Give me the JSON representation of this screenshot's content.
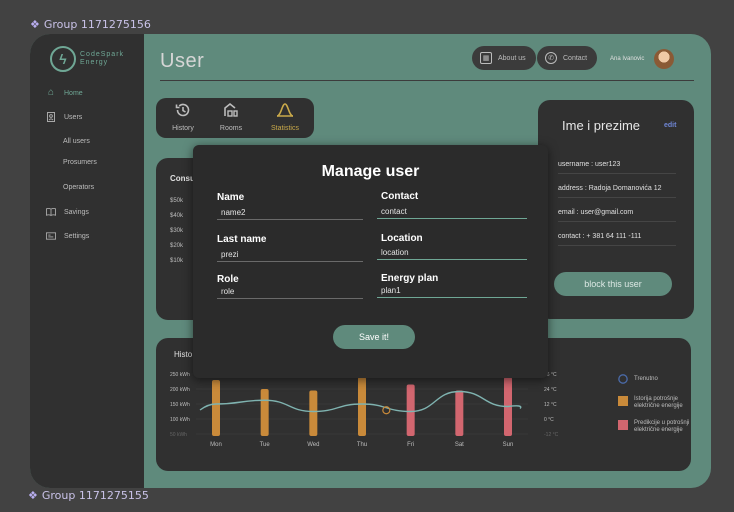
{
  "canvas": {
    "group_top": "Group 1171275156",
    "group_bottom": "Group 1171275155"
  },
  "brand": {
    "line1": "CodeSpark",
    "line2": "Energy"
  },
  "sidebar": {
    "items": [
      {
        "label": "Home",
        "icon": "home-icon",
        "active": true
      },
      {
        "label": "Users",
        "icon": "user-icon",
        "active": false
      },
      {
        "label": "Savings",
        "icon": "book-icon",
        "active": false
      },
      {
        "label": "Settings",
        "icon": "settings-icon",
        "active": false
      }
    ],
    "subitems": [
      "All users",
      "Prosumers",
      "Operators"
    ]
  },
  "header": {
    "title": "User",
    "about_label": "About us",
    "contact_label": "Contact",
    "user_name": "Ana Ivanovic"
  },
  "tabs": [
    {
      "label": "History",
      "icon": "history-icon",
      "active": false
    },
    {
      "label": "Rooms",
      "icon": "rooms-icon",
      "active": false
    },
    {
      "label": "Statistics",
      "icon": "statistics-icon",
      "active": true
    }
  ],
  "consumption": {
    "title": "Consu",
    "y_ticks": [
      "$50k",
      "$40k",
      "$30k",
      "$20k",
      "$10k"
    ]
  },
  "profile": {
    "name": "Ime i prezime",
    "edit_label": "edit",
    "username": "username : user123",
    "address": "address : Radoja Domanovića 12",
    "email": "email : user@gmail.com",
    "contact": "contact : + 381 64 111 -111",
    "block_label": "block this user"
  },
  "bottom_chart": {
    "title": "Histo",
    "legend": [
      {
        "label": "Trenutno",
        "color": "#4a6aa8"
      },
      {
        "label": "Istorija potrošnje električne energije",
        "color": "#c98a3a"
      },
      {
        "label": "Predikcije u potrošnji električne energije",
        "color": "#d2666f"
      }
    ]
  },
  "chart_data": {
    "type": "bar",
    "categories": [
      "Mon",
      "Tue",
      "Wed",
      "Thu",
      "Fri",
      "Sat",
      "Sun"
    ],
    "y_ticks": [
      "250 kWh",
      "200 kWh",
      "150 kWh",
      "100 kWh",
      "50 kWh"
    ],
    "y2_ticks": [
      "36 °C",
      "24 °C",
      "12 °C",
      "0 °C",
      "-12 °C"
    ],
    "ylim": [
      50,
      250
    ],
    "y2lim": [
      -12,
      36
    ],
    "series": [
      {
        "name": "Istorija potrošnje električne energije",
        "values": [
          230,
          200,
          195,
          240,
          null,
          null,
          null
        ],
        "color": "#c98a3a"
      },
      {
        "name": "Predikcije u potrošnji električne energije",
        "values": [
          null,
          null,
          null,
          null,
          215,
          195,
          240
        ],
        "color": "#d2666f"
      }
    ],
    "line": {
      "values": [
        12,
        15,
        6,
        12,
        6,
        22,
        10
      ],
      "color": "#7fb3b0"
    }
  },
  "modal": {
    "title": "Manage user",
    "fields": {
      "name": {
        "label": "Name",
        "value": "name2"
      },
      "last_name": {
        "label": "Last name",
        "value": "prezi"
      },
      "role": {
        "label": "Role",
        "value": "role"
      },
      "contact": {
        "label": "Contact",
        "value": "contact"
      },
      "location": {
        "label": "Location",
        "value": "location"
      },
      "energy_plan": {
        "label": "Energy plan",
        "value": "plan1"
      }
    },
    "save_label": "Save it!"
  }
}
